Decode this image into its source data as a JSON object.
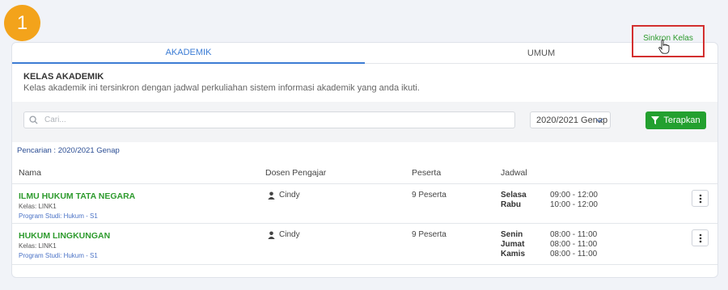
{
  "step_badge": "1",
  "tabs": [
    {
      "label": "AKADEMIK",
      "active": true
    },
    {
      "label": "UMUM",
      "active": false
    }
  ],
  "header": {
    "title": "KELAS AKADEMIK",
    "description": "Kelas akademik ini tersinkron dengan jadwal perkuliahan sistem informasi akademik yang anda ikuti.",
    "sync_button": "Sinkron Kelas"
  },
  "filters": {
    "search_placeholder": "Cari...",
    "period": "2020/2021 Genap",
    "apply_label": "Terapkan"
  },
  "search_info": "Pencarian : 2020/2021 Genap",
  "table": {
    "columns": [
      "Nama",
      "Dosen Pengajar",
      "Peserta",
      "Jadwal"
    ],
    "rows": [
      {
        "name": "ILMU HUKUM TATA NEGARA",
        "class": "Kelas: LINK1",
        "program": "Program Studi: Hukum - S1",
        "lecturer": "Cindy",
        "participants": "9 Peserta",
        "schedule": [
          {
            "day": "Selasa",
            "time": "09:00 - 12:00"
          },
          {
            "day": "Rabu",
            "time": "10:00 - 12:00"
          }
        ]
      },
      {
        "name": "HUKUM LINGKUNGAN",
        "class": "Kelas: LINK1",
        "program": "Program Studi: Hukum - S1",
        "lecturer": "Cindy",
        "participants": "9 Peserta",
        "schedule": [
          {
            "day": "Senin",
            "time": "08:00 - 11:00"
          },
          {
            "day": "Jumat",
            "time": "08:00 - 11:00"
          },
          {
            "day": "Kamis",
            "time": "08:00 - 11:00"
          }
        ]
      }
    ]
  },
  "colors": {
    "accent_green": "#23a02f",
    "tab_blue": "#3c7cd4",
    "badge_orange": "#f3a31b",
    "highlight_red": "#d32f2f"
  },
  "icons": {
    "search": "search-icon",
    "filter": "filter-icon",
    "dropdown": "chevron-down-icon",
    "lecturer": "user-icon",
    "more": "more-vertical-icon",
    "cursor": "hand-pointer-icon"
  }
}
